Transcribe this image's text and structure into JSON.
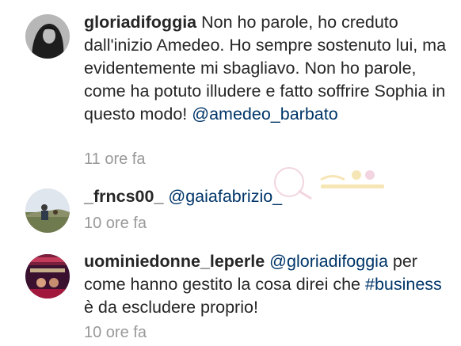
{
  "comments": [
    {
      "username": "gloriadifoggia",
      "text": "Non ho parole, ho creduto dall'inizio Amedeo. Ho sempre sostenuto lui, ma evidentemente mi sbagliavo. Non ho parole, come ha potuto illudere e fatto soffrire Sophia in questo modo!",
      "mention": "@amedeo_barbato",
      "time": "11 ore fa"
    },
    {
      "username": "_frncs00_",
      "mention": "@gaiafabrizio_",
      "time": "10 ore fa"
    },
    {
      "username": "uominiedonne_leperle",
      "mention": "@gloriadifoggia",
      "text_before_hashtag": "per come hanno gestito la cosa direi che",
      "hashtag": "#business",
      "text_after_hashtag": "è da escludere proprio!",
      "time": "10 ore fa"
    }
  ],
  "colors": {
    "username": "#262626",
    "text": "#262626",
    "link": "#003569",
    "time": "#999999"
  }
}
